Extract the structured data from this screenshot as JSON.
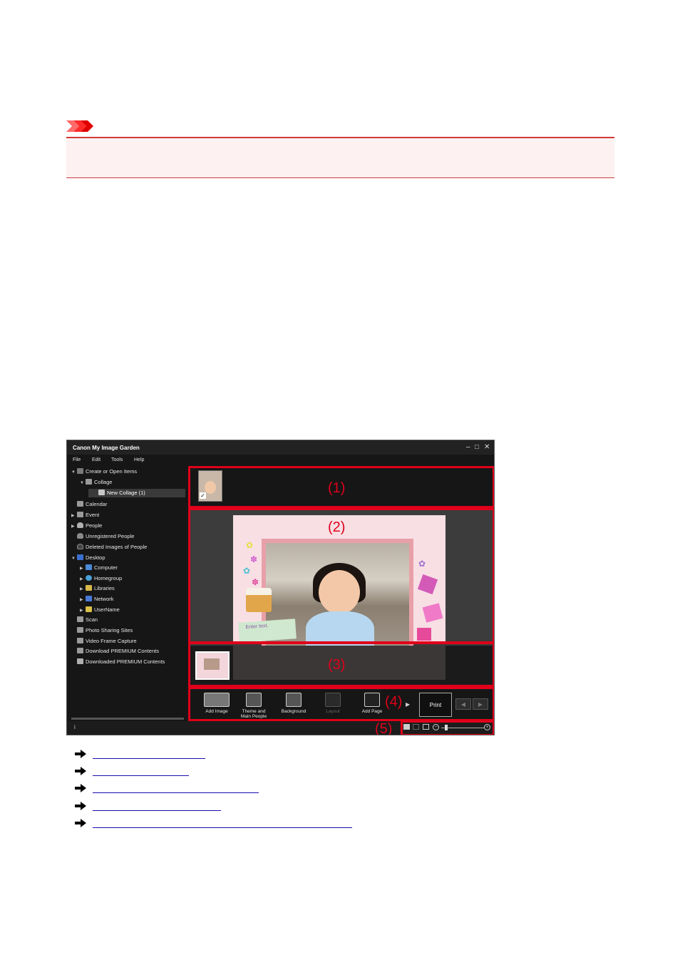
{
  "important_icon": "important-arrows-icon",
  "window": {
    "title": "Canon My Image Garden",
    "controls": [
      "–",
      "□",
      "✕"
    ],
    "menu": [
      "File",
      "Edit",
      "Tools",
      "Help"
    ]
  },
  "sidebar": {
    "items": [
      {
        "label": "Create or Open Items",
        "icon": "create-items-icon"
      },
      {
        "label": "Collage",
        "icon": "collage-icon"
      },
      {
        "label": "New Collage (1)",
        "icon": "collage-file-icon"
      },
      {
        "label": "Calendar",
        "icon": "calendar-icon"
      },
      {
        "label": "Event",
        "icon": "event-icon"
      },
      {
        "label": "People",
        "icon": "person-icon"
      },
      {
        "label": "Unregistered People",
        "icon": "person-unregistered-icon"
      },
      {
        "label": "Deleted Images of People",
        "icon": "person-deleted-icon"
      },
      {
        "label": "Desktop",
        "icon": "desktop-icon"
      },
      {
        "label": "Computer",
        "icon": "computer-icon"
      },
      {
        "label": "Homegroup",
        "icon": "homegroup-icon"
      },
      {
        "label": "Libraries",
        "icon": "libraries-icon"
      },
      {
        "label": "Network",
        "icon": "network-icon"
      },
      {
        "label": "UserName",
        "icon": "user-folder-icon"
      },
      {
        "label": "Scan",
        "icon": "scan-icon"
      },
      {
        "label": "Photo Sharing Sites",
        "icon": "photo-sharing-icon"
      },
      {
        "label": "Video Frame Capture",
        "icon": "video-frame-icon"
      },
      {
        "label": "Download PREMIUM Contents",
        "icon": "download-icon"
      },
      {
        "label": "Downloaded PREMIUM Contents",
        "icon": "folder-icon"
      }
    ]
  },
  "editor": {
    "text_placeholder": "Enter text."
  },
  "toolbar": {
    "add_image": "Add Image",
    "theme_line1": "Theme and",
    "theme_line2": "Main People",
    "background": "Background",
    "layout": "Layout",
    "add_page": "Add Page",
    "print": "Print"
  },
  "callouts": [
    "(1)",
    "(2)",
    "(3)",
    "(4)",
    "(5)"
  ],
  "colors": {
    "callout": "#e0001a",
    "link": "#1a0dab",
    "important": "#d23a3a"
  }
}
